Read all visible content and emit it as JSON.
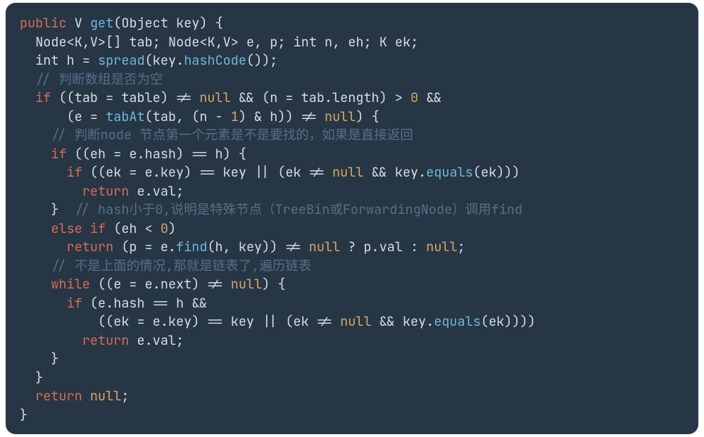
{
  "code": {
    "l1": {
      "kw_public": "public",
      "type_V": "V",
      "fn_get": "get",
      "type_Object": "Object",
      "arg": "key",
      "brace": "{"
    },
    "l2": {
      "type_Node": "Node",
      "gen": "<K,V>",
      "arr": "[]",
      "var_tab": "tab",
      "semi1": ";",
      "type_Node2": "Node",
      "gen2": "<K,V>",
      "vars_ep": "e, p",
      "semi2": ";",
      "type_int": "int",
      "vars_neh": "n, eh",
      "semi3": ";",
      "type_K": "K",
      "var_ek": "ek",
      "semi4": ";"
    },
    "l3": {
      "type_int": "int",
      "var_h": "h",
      "eq": "=",
      "fn_spread": "spread",
      "open": "(",
      "arg": "key.",
      "fn_hashCode": "hashCode",
      "close": "());"
    },
    "l4": {
      "comment": "// 判断数组是否为空"
    },
    "l5": {
      "kw_if": "if",
      "txt1": "((tab = table) != ",
      "nul": "null",
      "txt2": " && (n = tab.",
      "prop": "length",
      "txt3": ") > ",
      "zero": "0",
      "txt4": " &&"
    },
    "l6": {
      "txt1": "(e = ",
      "fn": "tabAt",
      "txt2": "(tab, (n - ",
      "one": "1",
      "txt3": ") & h)) != ",
      "nul": "null",
      "txt4": ") {"
    },
    "l7": {
      "comment": "// 判断node 节点第一个元素是不是要找的，如果是直接返回"
    },
    "l8": {
      "kw_if": "if",
      "txt": "((eh = e.",
      "prop": "hash",
      "txt2": ") == h) {"
    },
    "l9": {
      "kw_if": "if",
      "txt1": "((ek = e.",
      "prop": "key",
      "txt2": ") == key || (ek != ",
      "nul": "null",
      "txt3": " && key.",
      "fn": "equals",
      "txt4": "(ek)))"
    },
    "l10": {
      "kw_return": "return",
      "txt": " e.",
      "prop": "val",
      "semi": ";"
    },
    "l11": {
      "brace": "}",
      "comment": "// hash小于0,说明是特殊节点（TreeBin或ForwardingNode）调用find"
    },
    "l12": {
      "kw_else": "else",
      "kw_if": "if",
      "txt": "(eh < ",
      "zero": "0",
      "close": ")"
    },
    "l13": {
      "kw_return": "return",
      "txt1": " (p = e.",
      "fn": "find",
      "txt2": "(h, key)) != ",
      "nul1": "null",
      "txt3": " ? p.",
      "prop": "val",
      "txt4": " : ",
      "nul2": "null",
      "semi": ";"
    },
    "l14": {
      "comment": "// 不是上面的情况,那就是链表了,遍历链表"
    },
    "l15": {
      "kw_while": "while",
      "txt1": "((e = e.",
      "prop": "next",
      "txt2": ") != ",
      "nul": "null",
      "txt3": ") {"
    },
    "l16": {
      "kw_if": "if",
      "txt1": "(e.",
      "prop": "hash",
      "txt2": " == h &&"
    },
    "l17": {
      "txt1": "((ek = e.",
      "prop": "key",
      "txt2": ") == key || (ek != ",
      "nul": "null",
      "txt3": " && key.",
      "fn": "equals",
      "txt4": "(ek))))"
    },
    "l18": {
      "kw_return": "return",
      "txt": " e.",
      "prop": "val",
      "semi": ";"
    },
    "l19": {
      "brace": "}"
    },
    "l20": {
      "brace": "}"
    },
    "l21": {
      "kw_return": "return",
      "sp": " ",
      "nul": "null",
      "semi": ";"
    },
    "l22": {
      "brace": "}"
    }
  }
}
